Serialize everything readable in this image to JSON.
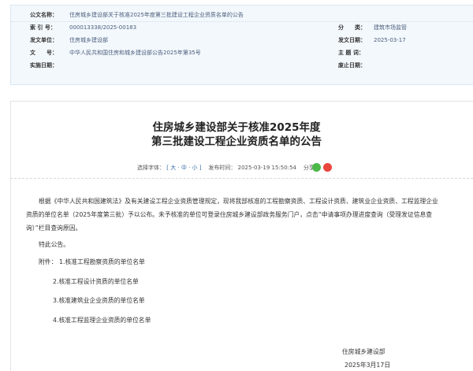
{
  "meta": {
    "rows": [
      {
        "label": "公文名称：",
        "value": "住房城乡建设部关于核准2025年度第三批建设工程企业资质名单的公告"
      },
      {
        "label": "索 引 号：",
        "value": "000013338/2025-00183",
        "label2": "分　　类：",
        "value2": "建筑市场监管"
      },
      {
        "label": "发文单位：",
        "value": "住房城乡建设部",
        "label2": "发文日期：",
        "value2": "2025-03-17"
      },
      {
        "label": "文　　号：",
        "value": "中华人民共和国住房和城乡建设部公告2025年第35号",
        "label2": "主 题 词：",
        "value2": ""
      },
      {
        "label": "实施日期：",
        "value": "",
        "label2": "废止日期：",
        "value2": ""
      }
    ]
  },
  "article": {
    "title_line1": "住房城乡建设部关于核准2025年度",
    "title_line2": "第三批建设工程企业资质名单的公告",
    "font_label": "选择字体：",
    "font_sizes": "[ 大 · 中 · 小 ]",
    "publish_label": "发布时间：",
    "publish_time": "2025-03-19 15:50:54",
    "share_label": "分享：",
    "body_p1_l1": "根据《中华人民共和国建筑法》及有关建设工程企业资质管理规定，现将我部核准的工程勘察资质、工程设计资质、建筑业企业资质、工程监理企业",
    "body_p1_l2": "资质的单位名单（2025年度第三批）予以公布。未予核准的单位可登录住房城乡建设部政务服务门户，点击“申请事项办理进度查询（受理发证信息查",
    "body_p1_l3": "询）”栏目查询原因。",
    "special": "特此公告。",
    "attach_label": "附件：",
    "attachments": [
      "1.核准工程勘察资质的单位名单",
      "2.核准工程设计资质的单位名单",
      "3.核准建筑业企业资质的单位名单",
      "4.核准工程监理企业资质的单位名单"
    ],
    "signer": "住房城乡建设部",
    "sign_date": "2025年3月17日"
  }
}
